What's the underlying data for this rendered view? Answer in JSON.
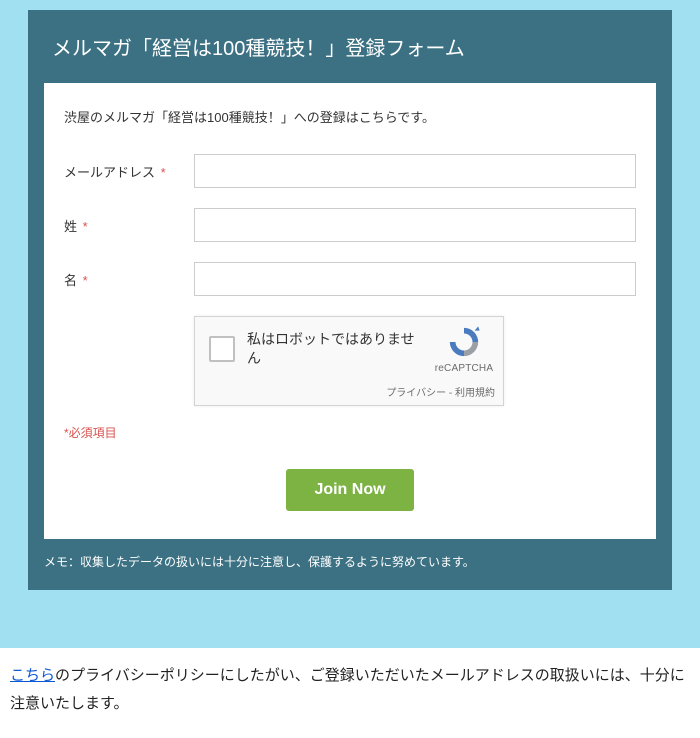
{
  "form": {
    "title": "メルマガ「経営は100種競技！」登録フォーム",
    "intro": "渋屋のメルマガ「経営は100種競技！」への登録はこちらです。",
    "required_mark": "*",
    "fields": {
      "email_label": "メールアドレス",
      "lastname_label": "姓",
      "firstname_label": "名",
      "email_value": "",
      "lastname_value": "",
      "firstname_value": ""
    },
    "captcha": {
      "label": "私はロボットではありません",
      "brand": "reCAPTCHA",
      "links": "プライバシー - 利用規約"
    },
    "required_note": "*必須項目",
    "submit_label": "Join Now",
    "footer_note": "メモ：収集したデータの扱いには十分に注意し、保護するように努めています。"
  },
  "page": {
    "policy_link_text": "こちら",
    "policy_tail": "のプライバシーポリシーにしたがい、ご登録いただいたメールアドレスの取扱いには、十分に注意いたします。"
  }
}
